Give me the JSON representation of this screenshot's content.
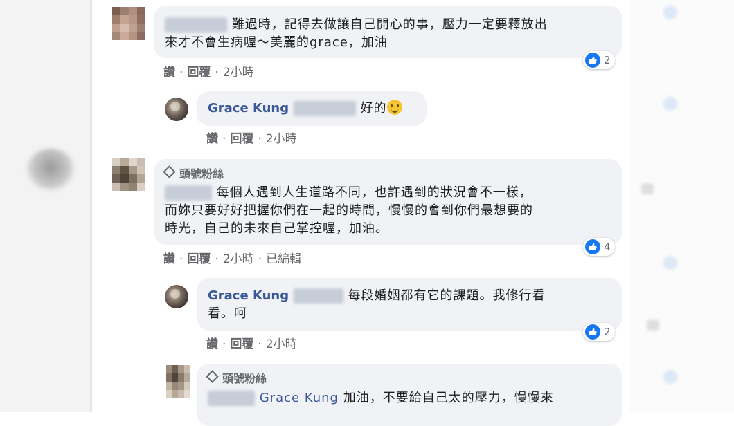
{
  "comments": [
    {
      "id": "c1",
      "badge": "",
      "author": "",
      "lines": [
        "難過時，記得去做讓自己開心的事，壓力一定要釋放出",
        "來才不會生病喔～美麗的grace，加油"
      ],
      "actions": {
        "like": "讚",
        "reply": "回覆",
        "time": "2小時",
        "edited": ""
      },
      "reaction_count": "2"
    },
    {
      "id": "r1",
      "badge": "",
      "author": "Grace Kung",
      "lines": [
        "好的"
      ],
      "actions": {
        "like": "讚",
        "reply": "回覆",
        "time": "2小時",
        "edited": ""
      },
      "reaction_count": ""
    },
    {
      "id": "c2",
      "badge": "頭號粉絲",
      "author": "",
      "lines": [
        "每個人遇到人生道路不同，也許遇到的狀況會不一樣，",
        "而妳只要好好把握你們在一起的時間，慢慢的會到你們最想要的",
        "時光，自己的未來自己掌控喔，加油。"
      ],
      "actions": {
        "like": "讚",
        "reply": "回覆",
        "time": "2小時",
        "edited": "已編輯"
      },
      "reaction_count": "4"
    },
    {
      "id": "r2",
      "badge": "",
      "author": "Grace Kung",
      "lines": [
        "每段婚姻都有它的課題。我修行看",
        "看。呵"
      ],
      "actions": {
        "like": "讚",
        "reply": "回覆",
        "time": "2小時",
        "edited": ""
      },
      "reaction_count": "2"
    },
    {
      "id": "r3",
      "badge": "頭號粉絲",
      "author": "",
      "mention": "Grace Kung",
      "lines": [
        "加油，不要給自己太的壓力，慢慢來"
      ],
      "actions": {
        "like": "",
        "reply": "",
        "time": "",
        "edited": ""
      },
      "reaction_count": ""
    }
  ],
  "icons": {
    "reaction": "like-icon",
    "badge": "diamond-icon",
    "emoji": "wink-emoji-icon"
  },
  "colors": {
    "bubble": "#f0f2f5",
    "author": "#385898",
    "like": "#1877f2",
    "meta": "#65676b"
  }
}
